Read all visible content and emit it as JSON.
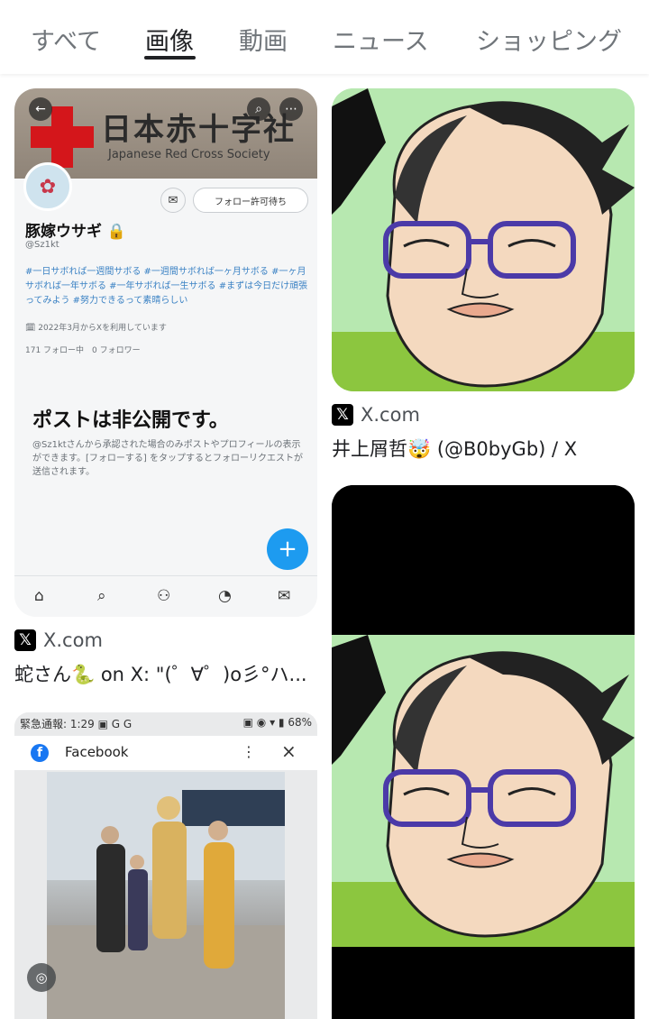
{
  "tabs": [
    {
      "label": "すべて",
      "active": false
    },
    {
      "label": "画像",
      "active": true
    },
    {
      "label": "動画",
      "active": false
    },
    {
      "label": "ニュース",
      "active": false
    },
    {
      "label": "ショッピング",
      "active": false
    }
  ],
  "results": [
    {
      "source": "X.com",
      "title": "蛇さん🐍 on X: \"(゜∀゜)o彡°ハ...",
      "thumb": {
        "banner_sign": "日本赤十字社",
        "banner_sign_en": "Japanese Red Cross Society",
        "follow_button": "フォロー許可待ち",
        "display_name": "豚嫁ウサギ 🔒",
        "handle": "@Sz1kt",
        "bio": "#一日サボれば一週間サボる #一週間サボれば一ヶ月サボる #一ヶ月サボれば一年サボる #一年サボれば一生サボる #まずは今日だけ頑張ってみよう #努力できるって素晴らしい",
        "joined": "🗓 2022年3月からXを利用しています",
        "counts": "171 フォロー中　0 フォロワー",
        "private_title": "ポストは非公開です。",
        "private_desc": "@Sz1ktさんから承認された場合のみポストやプロフィールの表示ができます。[フォローする] をタップするとフォローリクエストが送信されます。"
      }
    },
    {
      "source": "X.com",
      "title": "井上屑哲🤯 (@B0byGb) / X"
    },
    {
      "source": "Facebook",
      "thumb": {
        "status_left": "緊急通報: 1:29 ▣ G G",
        "status_right": "▣ ◉ ▾ ▮ 68%",
        "app_name": "Facebook"
      }
    }
  ],
  "colors": {
    "twitter_blue": "#1d9bf0",
    "facebook_blue": "#1877f2",
    "red_cross": "#d4161b",
    "caricature_bg": "#b7e8b0"
  }
}
